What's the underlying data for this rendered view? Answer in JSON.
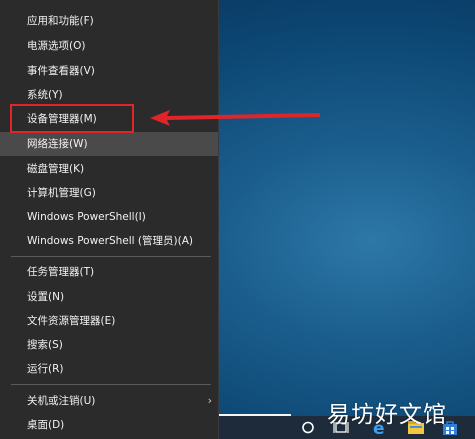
{
  "menu": {
    "groups": [
      [
        {
          "label": "应用和功能(F)"
        },
        {
          "label": "电源选项(O)"
        },
        {
          "label": "事件查看器(V)"
        },
        {
          "label": "系统(Y)"
        },
        {
          "label": "设备管理器(M)"
        },
        {
          "label": "网络连接(W)"
        },
        {
          "label": "磁盘管理(K)"
        },
        {
          "label": "计算机管理(G)"
        },
        {
          "label": "Windows PowerShell(I)"
        },
        {
          "label": "Windows PowerShell (管理员)(A)"
        }
      ],
      [
        {
          "label": "任务管理器(T)"
        },
        {
          "label": "设置(N)"
        },
        {
          "label": "文件资源管理器(E)"
        },
        {
          "label": "搜索(S)"
        },
        {
          "label": "运行(R)"
        }
      ],
      [
        {
          "label": "关机或注销(U)"
        },
        {
          "label": "桌面(D)"
        }
      ]
    ]
  },
  "taskbar": {
    "icons": [
      "search-circle-icon",
      "task-view-icon",
      "edge-icon",
      "file-explorer-icon",
      "store-icon"
    ]
  },
  "watermark": "易坊好文馆",
  "colors": {
    "menu_bg": "#2b2b2b",
    "hover_bg": "#4a4a4a",
    "annotation_red": "#e0242a",
    "desktop_blue": "#0c4673"
  }
}
